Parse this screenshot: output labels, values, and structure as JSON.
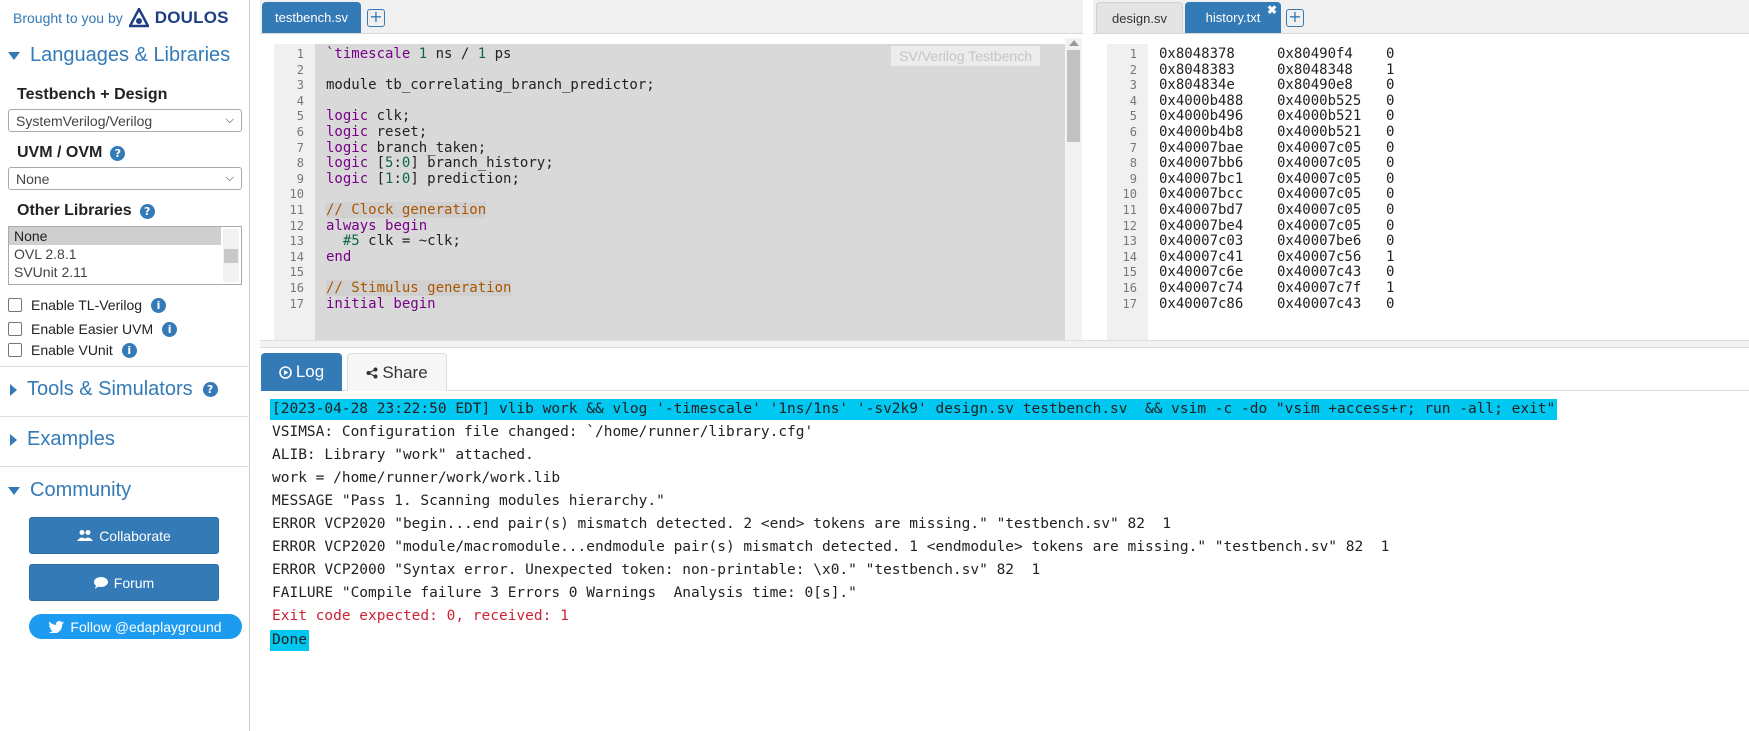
{
  "sidebar": {
    "brand_by": "Brought to you by",
    "brand_name": "DOULOS",
    "languages_section": "Languages & Libraries",
    "testbench_label": "Testbench + Design",
    "testbench_value": "SystemVerilog/Verilog",
    "uvm_label": "UVM / OVM",
    "uvm_value": "None",
    "other_label": "Other Libraries",
    "other_options": [
      "None",
      "OVL 2.8.1",
      "SVUnit 2.11"
    ],
    "checkboxes": [
      "Enable TL-Verilog",
      "Enable Easier UVM",
      "Enable VUnit"
    ],
    "tools_section": "Tools & Simulators",
    "examples_section": "Examples",
    "community_section": "Community",
    "collaborate_label": "Collaborate",
    "forum_label": "Forum",
    "follow_label": "Follow @edaplayground"
  },
  "left_editor": {
    "tab": "testbench.sv",
    "watermark": "SV/Verilog Testbench",
    "line_numbers": [
      "1",
      "2",
      "3",
      "4",
      "5",
      "6",
      "7",
      "8",
      "9",
      "10",
      "11",
      "12",
      "13",
      "14",
      "15",
      "16",
      "17"
    ]
  },
  "right_editor": {
    "tabs": [
      "design.sv",
      "history.txt"
    ],
    "close_glyph": "✖",
    "lines": [
      [
        "1",
        "0x8048378",
        "0x80490f4",
        "0"
      ],
      [
        "2",
        "0x8048383",
        "0x8048348",
        "1"
      ],
      [
        "3",
        "0x804834e",
        "0x80490e8",
        "0"
      ],
      [
        "4",
        "0x4000b488",
        "0x4000b525",
        "0"
      ],
      [
        "5",
        "0x4000b496",
        "0x4000b521",
        "0"
      ],
      [
        "6",
        "0x4000b4b8",
        "0x4000b521",
        "0"
      ],
      [
        "7",
        "0x40007bae",
        "0x40007c05",
        "0"
      ],
      [
        "8",
        "0x40007bb6",
        "0x40007c05",
        "0"
      ],
      [
        "9",
        "0x40007bc1",
        "0x40007c05",
        "0"
      ],
      [
        "10",
        "0x40007bcc",
        "0x40007c05",
        "0"
      ],
      [
        "11",
        "0x40007bd7",
        "0x40007c05",
        "0"
      ],
      [
        "12",
        "0x40007be4",
        "0x40007c05",
        "0"
      ],
      [
        "13",
        "0x40007c03",
        "0x40007be6",
        "0"
      ],
      [
        "14",
        "0x40007c41",
        "0x40007c56",
        "1"
      ],
      [
        "15",
        "0x40007c6e",
        "0x40007c43",
        "0"
      ],
      [
        "16",
        "0x40007c74",
        "0x40007c7f",
        "1"
      ],
      [
        "17",
        "0x40007c86",
        "0x40007c43",
        "0"
      ]
    ]
  },
  "log": {
    "tabs": [
      "Log",
      "Share"
    ],
    "lines": [
      "[2023-04-28 23:22:50 EDT] vlib work && vlog '-timescale' '1ns/1ns' '-sv2k9' design.sv testbench.sv  && vsim -c -do \"vsim +access+r; run -all; exit\"",
      "VSIMSA: Configuration file changed: `/home/runner/library.cfg'",
      "ALIB: Library \"work\" attached.",
      "work = /home/runner/work/work.lib",
      "MESSAGE \"Pass 1. Scanning modules hierarchy.\"",
      "ERROR VCP2020 \"begin...end pair(s) mismatch detected. 2 <end> tokens are missing.\" \"testbench.sv\" 82  1",
      "ERROR VCP2020 \"module/macromodule...endmodule pair(s) mismatch detected. 1 <endmodule> tokens are missing.\" \"testbench.sv\" 82  1",
      "ERROR VCP2000 \"Syntax error. Unexpected token: non-printable: \\x0.\" \"testbench.sv\" 82  1",
      "FAILURE \"Compile failure 3 Errors 0 Warnings  Analysis time: 0[s].\"",
      "Exit code expected: 0, received: 1",
      "Done"
    ]
  },
  "colors": {
    "accent": "#337ab7",
    "highlight": "#00c8f0",
    "error": "#cc2233"
  }
}
